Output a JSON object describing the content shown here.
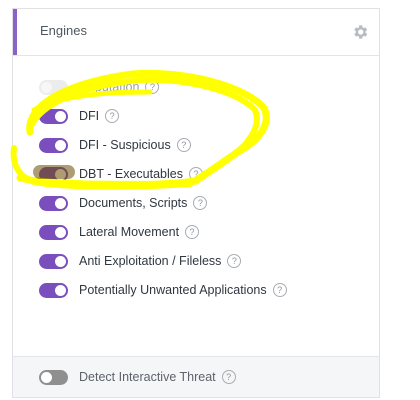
{
  "header": {
    "title": "Engines",
    "settings_icon": "gear-icon"
  },
  "engines": [
    {
      "label": "Reputation",
      "state": "disabled"
    },
    {
      "label": "DFI",
      "state": "on"
    },
    {
      "label": "DFI - Suspicious",
      "state": "on"
    },
    {
      "label": "DBT - Executables",
      "state": "on"
    },
    {
      "label": "Documents, Scripts",
      "state": "on"
    },
    {
      "label": "Lateral Movement",
      "state": "on"
    },
    {
      "label": "Anti Exploitation / Fileless",
      "state": "on"
    },
    {
      "label": "Potentially Unwanted Applications",
      "state": "on"
    }
  ],
  "footer": {
    "label": "Detect Interactive Threat",
    "state": "off"
  },
  "help_glyph": "?",
  "colors": {
    "accent": "#7a4fbd",
    "highlight": "#ffff00"
  }
}
